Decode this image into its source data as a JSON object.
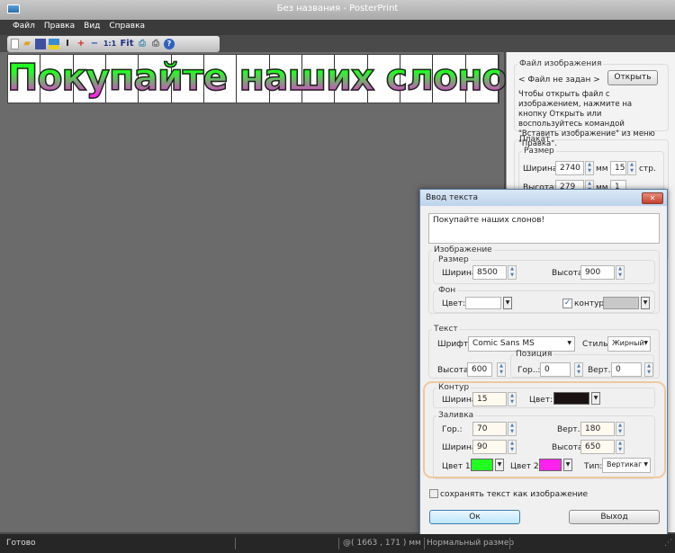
{
  "window": {
    "title": "Без названия - PosterPrint"
  },
  "menu": [
    "Файл",
    "Правка",
    "Вид",
    "Справка"
  ],
  "toolbar": {
    "actual_size": "1:1",
    "fit": "Fit"
  },
  "poster": {
    "text": "Покупайте наших слонов!",
    "pages": 15
  },
  "right_panel": {
    "image_file_legend": "Файл изображения",
    "no_file": "< Файл не задан >",
    "open_button": "Открыть",
    "hint": "Чтобы открыть файл с изображением, нажмите на кнопку Открыть или воспользуйтесь командой \"Вставить изображение\" из меню \"Правка\".",
    "poster_legend": "Плакат",
    "size_legend": "Размер",
    "width_label": "Ширина:",
    "width_value": "2740",
    "width_unit": "мм",
    "width_pages": "15",
    "pages_unit": "стр.",
    "height_label": "Высота:",
    "height_value": "279",
    "height_unit": "мм",
    "height_pages": "1"
  },
  "dialog": {
    "title": "Ввод текста",
    "text_value": "Покупайте наших слонов!",
    "image_legend": "Изображение",
    "size_legend": "Размер",
    "width_label": "Ширина:",
    "width_value": "8500",
    "height_label": "Высота:",
    "height_value": "900",
    "bg_legend": "Фон",
    "color_label": "Цвет:",
    "outline_checkbox": "контур",
    "text_legend": "Текст",
    "font_label": "Шрифт:",
    "font_value": "Comic Sans MS",
    "style_label": "Стиль:",
    "style_value": "Жирный",
    "text_height_label": "Высота:",
    "text_height_value": "600",
    "position_legend": "Позиция",
    "hor_label": "Гор..:",
    "hor_value": "0",
    "vert_label": "Верт.:",
    "vert_value": "0",
    "contour_legend": "Контур",
    "contour_width_label": "Ширина:",
    "contour_width_value": "15",
    "contour_color_label": "Цвет:",
    "fill_legend": "Заливка",
    "fill_hor_label": "Гор.:",
    "fill_hor_value": "70",
    "fill_vert_label": "Верт.:",
    "fill_vert_value": "180",
    "fill_width_label": "Ширина:",
    "fill_width_value": "90",
    "fill_height_label": "Высота:",
    "fill_height_value": "650",
    "color1_label": "Цвет 1:",
    "color2_label": "Цвет 2:",
    "type_label": "Тип:",
    "type_value": "Вертикаг",
    "save_as_image": "сохранять текст как изображение",
    "ok": "Ок",
    "exit": "Выход",
    "colors": {
      "bg": "#ffffff",
      "outline": "#c8c8c8",
      "contour": "#1a1212",
      "color1": "#22ff22",
      "color2": "#ff22ee"
    }
  },
  "status": {
    "ready": "Готово",
    "coords": "@( 1663 , 171 ) мм",
    "zoom": "Нормальный размер"
  }
}
